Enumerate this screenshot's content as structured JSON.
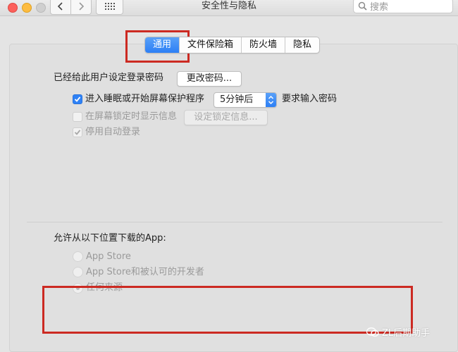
{
  "window": {
    "title": "安全性与隐私"
  },
  "search": {
    "placeholder": "搜索"
  },
  "tabs": [
    {
      "label": "通用",
      "active": true
    },
    {
      "label": "文件保险箱",
      "active": false
    },
    {
      "label": "防火墙",
      "active": false
    },
    {
      "label": "隐私",
      "active": false
    }
  ],
  "general": {
    "password_set_label": "已经给此用户设定登录密码",
    "change_password_button": "更改密码...",
    "require_password": {
      "label": "进入睡眠或开始屏幕保护程序",
      "checked": true,
      "delay_value": "5分钟后",
      "suffix": "要求输入密码"
    },
    "show_message": {
      "label": "在屏幕锁定时显示信息",
      "checked": false,
      "button": "设定锁定信息..."
    },
    "disable_auto_login": {
      "label": "停用自动登录",
      "checked": true
    }
  },
  "downloads": {
    "heading": "允许从以下位置下载的App:",
    "options": [
      {
        "label": "App Store",
        "selected": false
      },
      {
        "label": "App Store和被认可的开发者",
        "selected": false
      },
      {
        "label": "任何来源",
        "selected": true
      }
    ]
  },
  "watermark": {
    "text": "ZL后期助手"
  },
  "colors": {
    "accent": "#2f82f6",
    "highlight": "#cc2a22"
  }
}
